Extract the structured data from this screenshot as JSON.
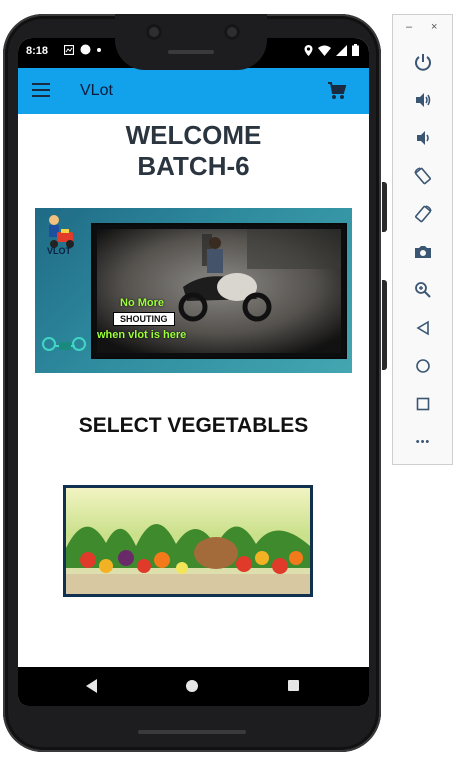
{
  "status_bar": {
    "time": "8:18",
    "left_icons": [
      "media-icon",
      "circle-icon",
      "dot-icon"
    ],
    "right_icons": [
      "location-icon",
      "wifi-icon",
      "signal-icon",
      "battery-icon"
    ]
  },
  "app_bar": {
    "title": "VLot",
    "menu_icon": "menu-icon",
    "cart_icon": "cart-icon",
    "color": "#12a2ec"
  },
  "welcome": {
    "line1": "WELCOME",
    "line2": "BATCH-6"
  },
  "banner": {
    "logo_text": "VLOT",
    "caption_line1": "No More",
    "caption_line2": "SHOUTING",
    "caption_line3": "when vlot is here"
  },
  "section": {
    "heading": "SELECT VEGETABLES"
  },
  "nav_bar": {
    "buttons": [
      "back-icon",
      "home-icon",
      "recents-icon"
    ]
  },
  "emulator_toolbar": {
    "minimize": "–",
    "close": "×",
    "buttons": [
      "power-icon",
      "volume-up-icon",
      "volume-down-icon",
      "rotate-left-icon",
      "rotate-right-icon",
      "camera-icon",
      "zoom-icon",
      "back-icon",
      "home-icon",
      "overview-icon",
      "more-icon"
    ],
    "more_label": "•••"
  }
}
